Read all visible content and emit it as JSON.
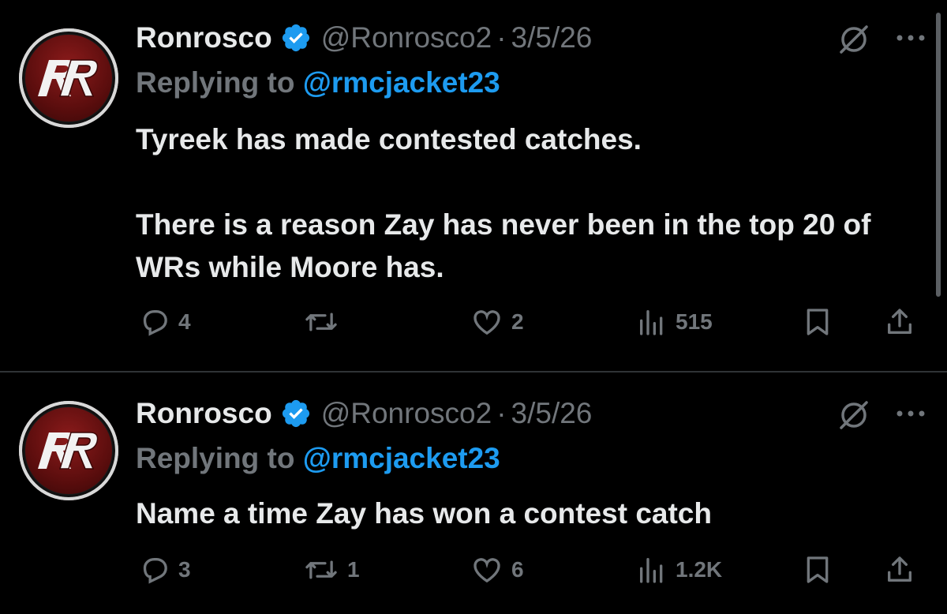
{
  "tweets": [
    {
      "display_name": "Ronrosco",
      "handle": "@Ronrosco2",
      "separator": "·",
      "time": "3/5/26",
      "reply_prefix": "Replying to",
      "reply_handle": "@rmcjacket23",
      "text": [
        "Tyreek has made contested catches.",
        "There is a reason Zay has never been in the top 20 of WRs while Moore has."
      ],
      "replies": "4",
      "reposts": "",
      "likes": "2",
      "views": "515"
    },
    {
      "display_name": "Ronrosco",
      "handle": "@Ronrosco2",
      "separator": "·",
      "time": "3/5/26",
      "reply_prefix": "Replying to",
      "reply_handle": "@rmcjacket23",
      "text": [
        "Name a time Zay has won a contest catch"
      ],
      "replies": "3",
      "reposts": "1",
      "likes": "6",
      "views": "1.2K"
    }
  ],
  "icons": {
    "avatar": "rr-logo",
    "verified": "verified-badge-icon",
    "grok": "grok-icon",
    "more": "more-icon",
    "reply": "reply-icon",
    "repost": "repost-icon",
    "like": "like-icon",
    "views": "views-icon",
    "bookmark": "bookmark-icon",
    "share": "share-icon"
  },
  "colors": {
    "background": "#000000",
    "text": "#e7e9ea",
    "secondary": "#71767b",
    "accent": "#1d9bf0",
    "avatar_red": "#8c1b1b"
  }
}
